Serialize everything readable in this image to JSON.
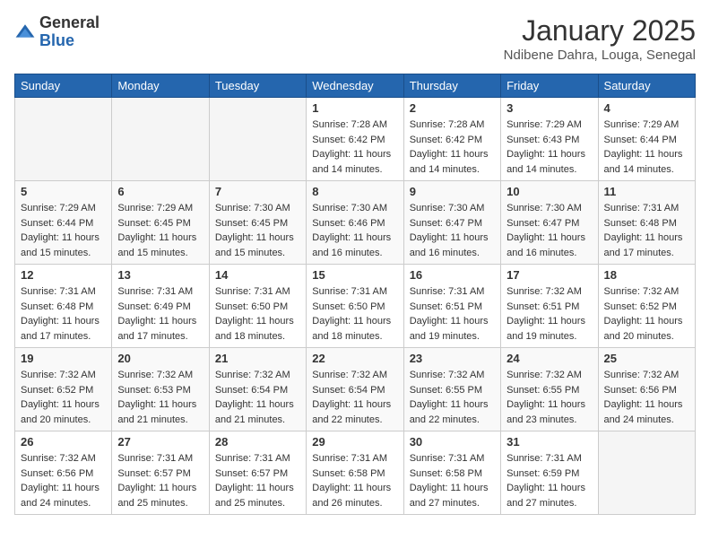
{
  "header": {
    "logo_general": "General",
    "logo_blue": "Blue",
    "month_title": "January 2025",
    "location": "Ndibene Dahra, Louga, Senegal"
  },
  "days_of_week": [
    "Sunday",
    "Monday",
    "Tuesday",
    "Wednesday",
    "Thursday",
    "Friday",
    "Saturday"
  ],
  "weeks": [
    [
      {
        "day": "",
        "sunrise": "",
        "sunset": "",
        "daylight": "",
        "empty": true
      },
      {
        "day": "",
        "sunrise": "",
        "sunset": "",
        "daylight": "",
        "empty": true
      },
      {
        "day": "",
        "sunrise": "",
        "sunset": "",
        "daylight": "",
        "empty": true
      },
      {
        "day": "1",
        "sunrise": "Sunrise: 7:28 AM",
        "sunset": "Sunset: 6:42 PM",
        "daylight": "Daylight: 11 hours and 14 minutes."
      },
      {
        "day": "2",
        "sunrise": "Sunrise: 7:28 AM",
        "sunset": "Sunset: 6:42 PM",
        "daylight": "Daylight: 11 hours and 14 minutes."
      },
      {
        "day": "3",
        "sunrise": "Sunrise: 7:29 AM",
        "sunset": "Sunset: 6:43 PM",
        "daylight": "Daylight: 11 hours and 14 minutes."
      },
      {
        "day": "4",
        "sunrise": "Sunrise: 7:29 AM",
        "sunset": "Sunset: 6:44 PM",
        "daylight": "Daylight: 11 hours and 14 minutes."
      }
    ],
    [
      {
        "day": "5",
        "sunrise": "Sunrise: 7:29 AM",
        "sunset": "Sunset: 6:44 PM",
        "daylight": "Daylight: 11 hours and 15 minutes."
      },
      {
        "day": "6",
        "sunrise": "Sunrise: 7:29 AM",
        "sunset": "Sunset: 6:45 PM",
        "daylight": "Daylight: 11 hours and 15 minutes."
      },
      {
        "day": "7",
        "sunrise": "Sunrise: 7:30 AM",
        "sunset": "Sunset: 6:45 PM",
        "daylight": "Daylight: 11 hours and 15 minutes."
      },
      {
        "day": "8",
        "sunrise": "Sunrise: 7:30 AM",
        "sunset": "Sunset: 6:46 PM",
        "daylight": "Daylight: 11 hours and 16 minutes."
      },
      {
        "day": "9",
        "sunrise": "Sunrise: 7:30 AM",
        "sunset": "Sunset: 6:47 PM",
        "daylight": "Daylight: 11 hours and 16 minutes."
      },
      {
        "day": "10",
        "sunrise": "Sunrise: 7:30 AM",
        "sunset": "Sunset: 6:47 PM",
        "daylight": "Daylight: 11 hours and 16 minutes."
      },
      {
        "day": "11",
        "sunrise": "Sunrise: 7:31 AM",
        "sunset": "Sunset: 6:48 PM",
        "daylight": "Daylight: 11 hours and 17 minutes."
      }
    ],
    [
      {
        "day": "12",
        "sunrise": "Sunrise: 7:31 AM",
        "sunset": "Sunset: 6:48 PM",
        "daylight": "Daylight: 11 hours and 17 minutes."
      },
      {
        "day": "13",
        "sunrise": "Sunrise: 7:31 AM",
        "sunset": "Sunset: 6:49 PM",
        "daylight": "Daylight: 11 hours and 17 minutes."
      },
      {
        "day": "14",
        "sunrise": "Sunrise: 7:31 AM",
        "sunset": "Sunset: 6:50 PM",
        "daylight": "Daylight: 11 hours and 18 minutes."
      },
      {
        "day": "15",
        "sunrise": "Sunrise: 7:31 AM",
        "sunset": "Sunset: 6:50 PM",
        "daylight": "Daylight: 11 hours and 18 minutes."
      },
      {
        "day": "16",
        "sunrise": "Sunrise: 7:31 AM",
        "sunset": "Sunset: 6:51 PM",
        "daylight": "Daylight: 11 hours and 19 minutes."
      },
      {
        "day": "17",
        "sunrise": "Sunrise: 7:32 AM",
        "sunset": "Sunset: 6:51 PM",
        "daylight": "Daylight: 11 hours and 19 minutes."
      },
      {
        "day": "18",
        "sunrise": "Sunrise: 7:32 AM",
        "sunset": "Sunset: 6:52 PM",
        "daylight": "Daylight: 11 hours and 20 minutes."
      }
    ],
    [
      {
        "day": "19",
        "sunrise": "Sunrise: 7:32 AM",
        "sunset": "Sunset: 6:52 PM",
        "daylight": "Daylight: 11 hours and 20 minutes."
      },
      {
        "day": "20",
        "sunrise": "Sunrise: 7:32 AM",
        "sunset": "Sunset: 6:53 PM",
        "daylight": "Daylight: 11 hours and 21 minutes."
      },
      {
        "day": "21",
        "sunrise": "Sunrise: 7:32 AM",
        "sunset": "Sunset: 6:54 PM",
        "daylight": "Daylight: 11 hours and 21 minutes."
      },
      {
        "day": "22",
        "sunrise": "Sunrise: 7:32 AM",
        "sunset": "Sunset: 6:54 PM",
        "daylight": "Daylight: 11 hours and 22 minutes."
      },
      {
        "day": "23",
        "sunrise": "Sunrise: 7:32 AM",
        "sunset": "Sunset: 6:55 PM",
        "daylight": "Daylight: 11 hours and 22 minutes."
      },
      {
        "day": "24",
        "sunrise": "Sunrise: 7:32 AM",
        "sunset": "Sunset: 6:55 PM",
        "daylight": "Daylight: 11 hours and 23 minutes."
      },
      {
        "day": "25",
        "sunrise": "Sunrise: 7:32 AM",
        "sunset": "Sunset: 6:56 PM",
        "daylight": "Daylight: 11 hours and 24 minutes."
      }
    ],
    [
      {
        "day": "26",
        "sunrise": "Sunrise: 7:32 AM",
        "sunset": "Sunset: 6:56 PM",
        "daylight": "Daylight: 11 hours and 24 minutes."
      },
      {
        "day": "27",
        "sunrise": "Sunrise: 7:31 AM",
        "sunset": "Sunset: 6:57 PM",
        "daylight": "Daylight: 11 hours and 25 minutes."
      },
      {
        "day": "28",
        "sunrise": "Sunrise: 7:31 AM",
        "sunset": "Sunset: 6:57 PM",
        "daylight": "Daylight: 11 hours and 25 minutes."
      },
      {
        "day": "29",
        "sunrise": "Sunrise: 7:31 AM",
        "sunset": "Sunset: 6:58 PM",
        "daylight": "Daylight: 11 hours and 26 minutes."
      },
      {
        "day": "30",
        "sunrise": "Sunrise: 7:31 AM",
        "sunset": "Sunset: 6:58 PM",
        "daylight": "Daylight: 11 hours and 27 minutes."
      },
      {
        "day": "31",
        "sunrise": "Sunrise: 7:31 AM",
        "sunset": "Sunset: 6:59 PM",
        "daylight": "Daylight: 11 hours and 27 minutes."
      },
      {
        "day": "",
        "sunrise": "",
        "sunset": "",
        "daylight": "",
        "empty": true
      }
    ]
  ]
}
